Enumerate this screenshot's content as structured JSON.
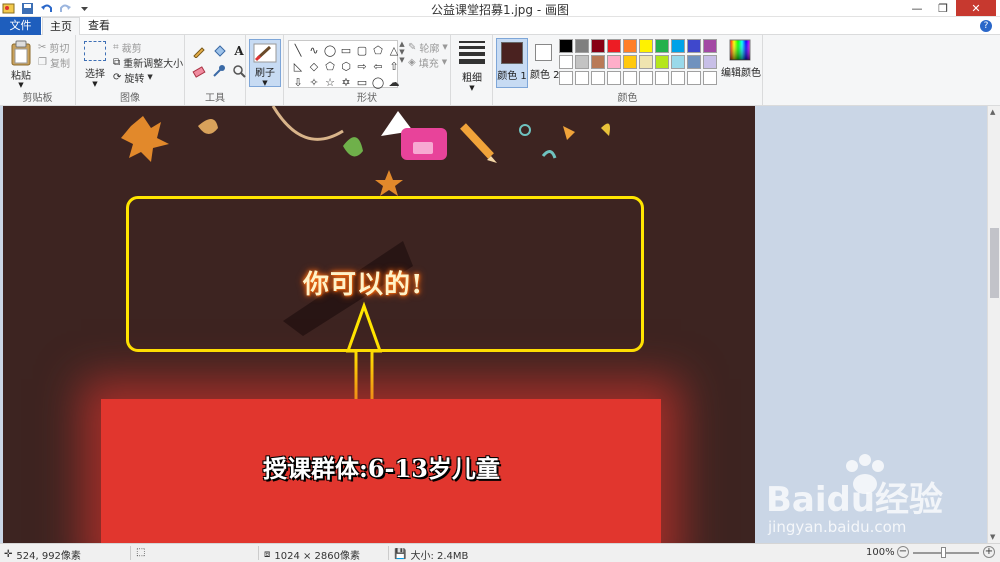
{
  "window": {
    "title": "公益课堂招募1.jpg - 画图",
    "controls": {
      "minimize": "—",
      "maximize": "❐",
      "close": "✕"
    }
  },
  "tabs": {
    "file": "文件",
    "home": "主页",
    "view": "查看"
  },
  "help": "?",
  "ribbon": {
    "clipboard": {
      "paste": "粘贴",
      "cut": "剪切",
      "copy": "复制",
      "label": "剪贴板"
    },
    "image": {
      "select": "选择",
      "crop": "裁剪",
      "resize": "重新调整大小",
      "rotate": "旋转",
      "label": "图像"
    },
    "tools": {
      "label": "工具"
    },
    "brushes": {
      "label": "刷子"
    },
    "shapes": {
      "outline": "轮廓",
      "fill": "填充",
      "label": "形状"
    },
    "size": {
      "label": "粗细"
    },
    "colors": {
      "color1": "颜色 1",
      "color2": "颜色 2",
      "edit": "编辑颜色",
      "label": "颜色",
      "color1_value": "#4a2220",
      "color2_value": "#ffffff",
      "palette": [
        "#000000",
        "#7f7f7f",
        "#880015",
        "#ed1c24",
        "#ff7f27",
        "#fff200",
        "#22b14c",
        "#00a2e8",
        "#3f48cc",
        "#a349a4",
        "#ffffff",
        "#c3c3c3",
        "#b97a57",
        "#ffaec9",
        "#ffc90e",
        "#efe4b0",
        "#b5e61d",
        "#99d9ea",
        "#7092be",
        "#c8bfe7",
        "#ffffff",
        "#ffffff",
        "#ffffff",
        "#ffffff",
        "#ffffff",
        "#ffffff",
        "#ffffff",
        "#ffffff",
        "#ffffff",
        "#ffffff"
      ]
    }
  },
  "canvas": {
    "banner_text": "你可以的!",
    "caption": "授课群体:6-13岁儿童"
  },
  "watermark": {
    "brand": "Baidu经验",
    "url": "jingyan.baidu.com"
  },
  "status": {
    "cursor": "524, 992像素",
    "image_size": "1024 × 2860像素",
    "file_size": "大小: 2.4MB",
    "zoom": "100%",
    "zoom_out": "−",
    "zoom_in": "+"
  }
}
